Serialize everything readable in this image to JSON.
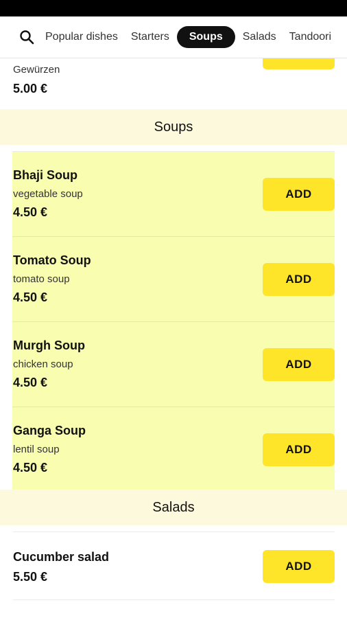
{
  "nav": {
    "tabs": [
      {
        "label": "Popular dishes",
        "active": false
      },
      {
        "label": "Starters",
        "active": false
      },
      {
        "label": "Soups",
        "active": true
      },
      {
        "label": "Salads",
        "active": false
      },
      {
        "label": "Tandoori",
        "active": false
      }
    ]
  },
  "previous_item": {
    "description": "Gewürzen",
    "price": "5.00 €"
  },
  "sections": {
    "soups": {
      "title": "Soups",
      "items": [
        {
          "name": "Bhaji Soup",
          "description": "vegetable soup",
          "price": "4.50 €",
          "button": "ADD"
        },
        {
          "name": "Tomato Soup",
          "description": "tomato soup",
          "price": "4.50 €",
          "button": "ADD"
        },
        {
          "name": "Murgh Soup",
          "description": "chicken soup",
          "price": "4.50 €",
          "button": "ADD"
        },
        {
          "name": "Ganga Soup",
          "description": "lentil soup",
          "price": "4.50 €",
          "button": "ADD"
        }
      ]
    },
    "salads": {
      "title": "Salads",
      "items": [
        {
          "name": "Cucumber salad",
          "price": "5.50 €",
          "button": "ADD"
        }
      ]
    }
  },
  "colors": {
    "accent_button": "#ffe52a",
    "highlight": "#f8fdb0",
    "section_header_bg": "#fdf9dc",
    "active_tab_bg": "#111111"
  },
  "icons": {
    "search": "search-icon"
  }
}
